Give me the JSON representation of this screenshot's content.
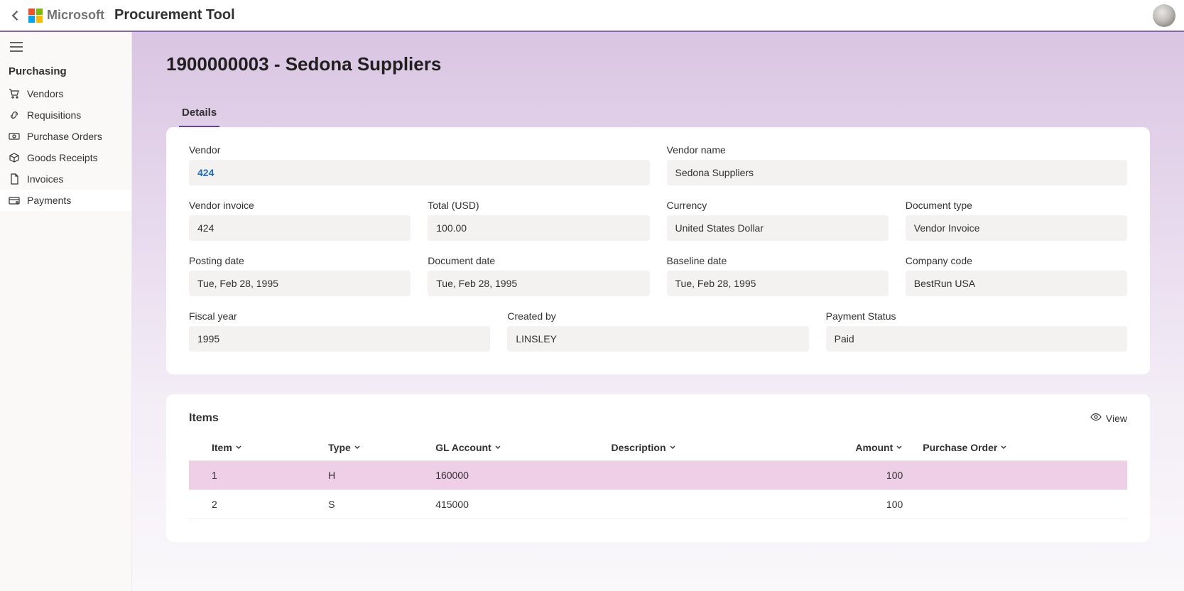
{
  "header": {
    "ms_text": "Microsoft",
    "app_title": "Procurement Tool"
  },
  "sidebar": {
    "section": "Purchasing",
    "items": [
      {
        "label": "Vendors"
      },
      {
        "label": "Requisitions"
      },
      {
        "label": "Purchase Orders"
      },
      {
        "label": "Goods Receipts"
      },
      {
        "label": "Invoices"
      },
      {
        "label": "Payments"
      }
    ]
  },
  "page": {
    "title": "1900000003 - Sedona Suppliers"
  },
  "tabs": [
    {
      "label": "Details"
    }
  ],
  "details": {
    "vendor": {
      "label": "Vendor",
      "value": "424"
    },
    "vendor_name": {
      "label": "Vendor name",
      "value": "Sedona Suppliers"
    },
    "vendor_invoice": {
      "label": "Vendor invoice",
      "value": "424"
    },
    "total_usd": {
      "label": "Total (USD)",
      "value": "100.00"
    },
    "currency": {
      "label": "Currency",
      "value": "United States Dollar"
    },
    "document_type": {
      "label": "Document type",
      "value": "Vendor Invoice"
    },
    "posting_date": {
      "label": "Posting date",
      "value": "Tue, Feb 28, 1995"
    },
    "document_date": {
      "label": "Document date",
      "value": "Tue, Feb 28, 1995"
    },
    "baseline_date": {
      "label": "Baseline date",
      "value": "Tue, Feb 28, 1995"
    },
    "company_code": {
      "label": "Company code",
      "value": "BestRun USA"
    },
    "fiscal_year": {
      "label": "Fiscal year",
      "value": "1995"
    },
    "created_by": {
      "label": "Created by",
      "value": "LINSLEY"
    },
    "payment_status": {
      "label": "Payment Status",
      "value": "Paid"
    }
  },
  "items_section": {
    "title": "Items",
    "view_label": "View",
    "columns": {
      "item": "Item",
      "type": "Type",
      "gl_account": "GL Account",
      "description": "Description",
      "amount": "Amount",
      "purchase_order": "Purchase Order"
    },
    "rows": [
      {
        "item": "1",
        "type": "H",
        "gl_account": "160000",
        "description": "",
        "amount": "100",
        "purchase_order": ""
      },
      {
        "item": "2",
        "type": "S",
        "gl_account": "415000",
        "description": "",
        "amount": "100",
        "purchase_order": ""
      }
    ]
  }
}
